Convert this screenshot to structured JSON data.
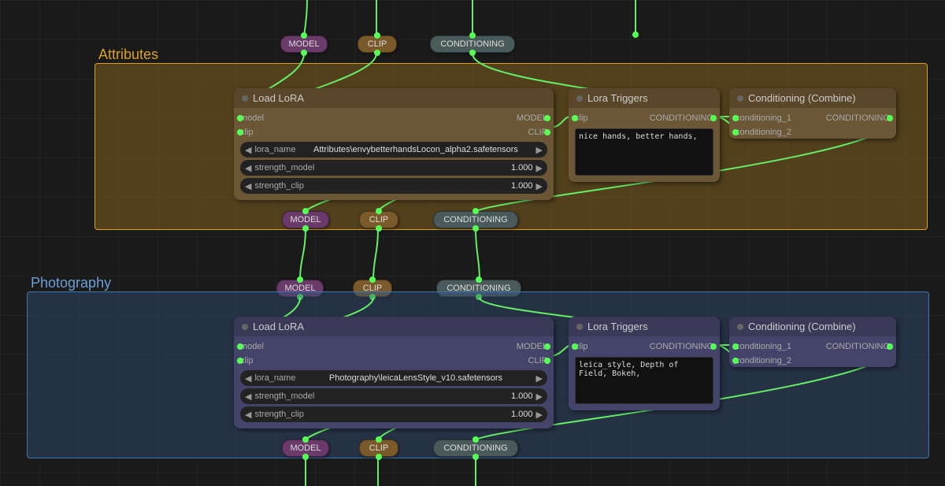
{
  "groups": {
    "attributes": {
      "title": "Attributes",
      "color_border": "#d8a020",
      "color_fill": "rgba(150,110,30,0.45)"
    },
    "photography": {
      "title": "Photography",
      "color_border": "#3b78b5",
      "color_fill": "rgba(50,80,120,0.45)"
    }
  },
  "pills": {
    "model": "MODEL",
    "clip": "CLIP",
    "conditioning": "CONDITIONING"
  },
  "pill_colors": {
    "model": "#6a3a6a",
    "clip": "#7a5a2a",
    "conditioning": "#4a5a5a"
  },
  "nodes": {
    "load_lora": {
      "title": "Load LoRA",
      "inputs": [
        "model",
        "clip"
      ],
      "outputs": [
        "MODEL",
        "CLIP"
      ],
      "widgets": {
        "lora_name_label": "lora_name",
        "strength_model_label": "strength_model",
        "strength_model_value": "1.000",
        "strength_clip_label": "strength_clip",
        "strength_clip_value": "1.000"
      }
    },
    "lora_triggers": {
      "title": "Lora Triggers",
      "inputs": [
        "clip"
      ],
      "outputs": [
        "CONDITIONING"
      ]
    },
    "conditioning_combine": {
      "title": "Conditioning (Combine)",
      "inputs": [
        "conditioning_1",
        "conditioning_2"
      ],
      "outputs": [
        "CONDITIONING"
      ]
    },
    "attributes": {
      "lora_name_value": "Attributes\\envybetterhandsLocon_alpha2.safetensors",
      "triggers_text": "nice hands, better hands,"
    },
    "photography": {
      "lora_name_value": "Photography\\leicaLensStyle_v10.safetensors",
      "triggers_text": "leica_style, Depth of Field, Bokeh,"
    }
  },
  "node_colors": {
    "attributes_header": "#5a4628",
    "attributes_body": "#6b5736",
    "photography_header": "#3a3a58",
    "photography_body": "#44446a"
  }
}
